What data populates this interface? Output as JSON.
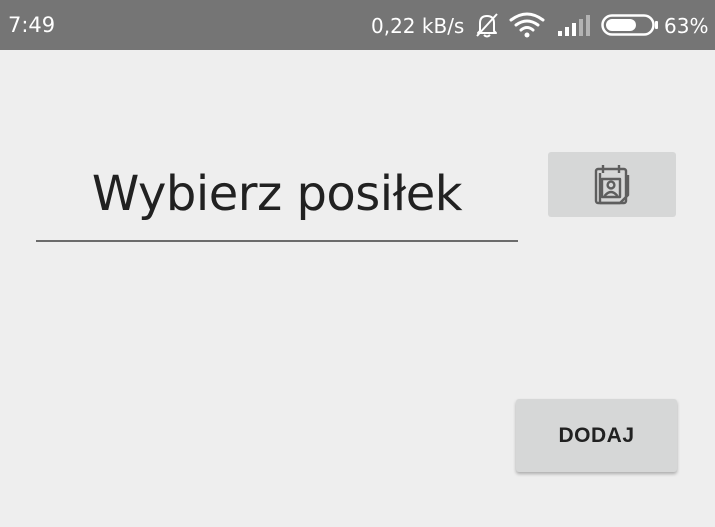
{
  "status_bar": {
    "time": "7:49",
    "network_speed": "0,22 kB/s",
    "battery_percent": "63%",
    "icons": [
      "notifications-off-icon",
      "wifi-icon",
      "signal-icon",
      "battery-icon"
    ]
  },
  "meal_input": {
    "value": "Wybierz posiłek"
  },
  "calendar_button": {
    "icon": "calendar-contact-icon"
  },
  "add_button": {
    "label": "DODAJ"
  },
  "colors": {
    "status_bar_bg": "#757575",
    "page_bg": "#eeeeee",
    "button_bg": "#d6d7d7",
    "text": "#212121"
  }
}
